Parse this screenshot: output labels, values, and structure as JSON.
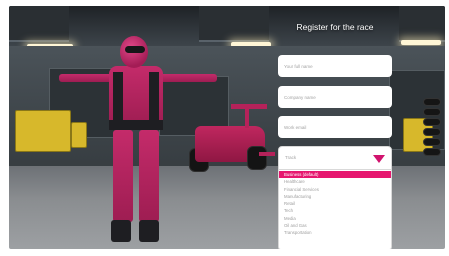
{
  "form": {
    "title": "Register for the race",
    "fields": {
      "full_name": {
        "placeholder": "Your full name"
      },
      "company": {
        "placeholder": "Company name"
      },
      "email": {
        "placeholder": "Work email"
      }
    },
    "track": {
      "placeholder": "Track",
      "options": [
        "Business (default)",
        "Healthcare",
        "Financial Services",
        "Manufacturing",
        "Retail",
        "Tech",
        "Media",
        "Oil and Gas",
        "Transportation"
      ],
      "selected_index": 0
    }
  },
  "colors": {
    "accent": "#e6176f",
    "suit": "#c42b6a",
    "panel_field": "#ffffff"
  }
}
